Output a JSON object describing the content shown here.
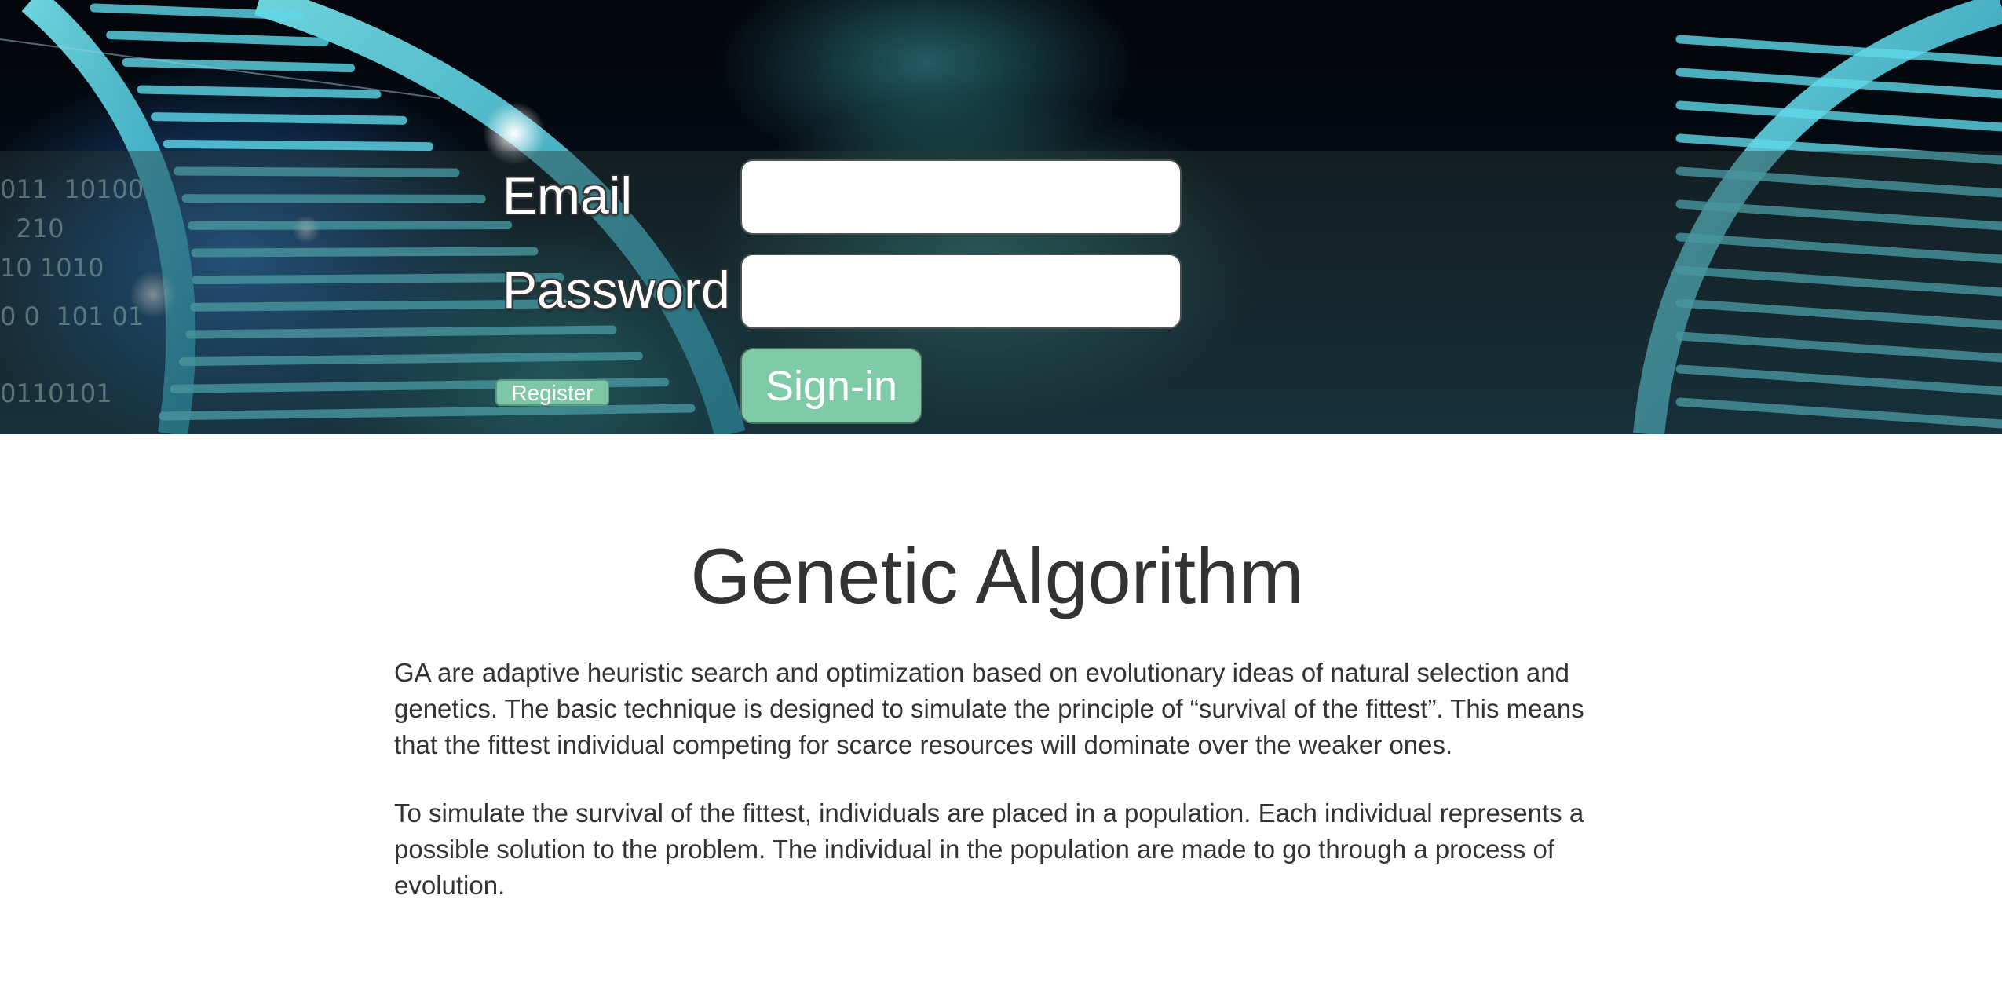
{
  "login": {
    "email_label": "Email",
    "email_value": "",
    "password_label": "Password",
    "password_value": "",
    "register_label": "Register",
    "signin_label": "Sign-in"
  },
  "hero": {
    "background": "dna-helix-image",
    "binary_lines": [
      "011  10100",
      "  210",
      "10 1010",
      "0 0  101 01",
      "0110101"
    ]
  },
  "content": {
    "title": "Genetic Algorithm",
    "paragraph_1": "GA are adaptive heuristic search and optimization based on evolutionary ideas of natural selection and genetics. The basic technique is designed to simulate the principle of “survival of the fittest”. This means that the fittest individual competing for scarce resources will dominate over the weaker ones.",
    "paragraph_2": "To simulate the survival of the fittest, individuals are placed in a population. Each individual represents a possible solution to the problem. The individual in the population are made to go through a process of evolution."
  },
  "colors": {
    "button_green": "#7fcba8",
    "text": "#333333",
    "overlay": "#283a38"
  }
}
